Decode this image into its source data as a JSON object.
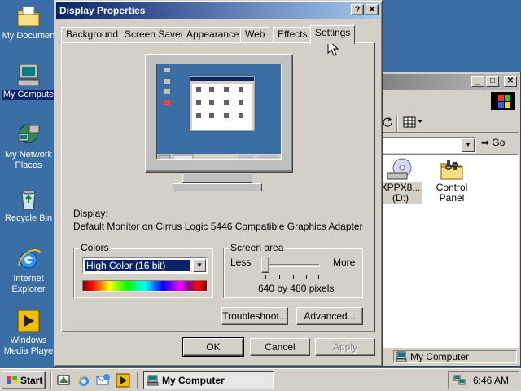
{
  "desktop": {
    "icons": [
      {
        "label": "My Documen",
        "icon": "folder-documents-icon",
        "selected": false
      },
      {
        "label": "My Compute",
        "icon": "computer-icon",
        "selected": true
      },
      {
        "label_line1": "My Network",
        "label_line2": "Places",
        "icon": "network-places-icon"
      },
      {
        "label": "Recycle Bin",
        "icon": "recycle-bin-icon"
      },
      {
        "label_line1": "Internet",
        "label_line2": "Explorer",
        "icon": "internet-explorer-icon"
      },
      {
        "label_line1": "Windows",
        "label_line2": "Media Playe",
        "icon": "media-player-icon"
      }
    ]
  },
  "explorer": {
    "address_go": "Go",
    "items": [
      {
        "label_line1": "XPPX8...",
        "label_line2": "(D:)",
        "icon": "cd-drive-icon"
      },
      {
        "label": "Control Panel",
        "icon": "control-panel-icon"
      }
    ],
    "status": "My Computer"
  },
  "dialog": {
    "title": "Display Properties",
    "help_glyph": "?",
    "close_glyph": "✕",
    "tabs": [
      {
        "label": "Background",
        "active": false
      },
      {
        "label": "Screen Saver",
        "active": false
      },
      {
        "label": "Appearance",
        "active": false
      },
      {
        "label": "Web",
        "active": false
      },
      {
        "label": "Effects",
        "active": false
      },
      {
        "label": "Settings",
        "active": true
      }
    ],
    "display_label": "Display:",
    "display_value": "Default Monitor on Cirrus Logic 5446 Compatible Graphics Adapter",
    "colors": {
      "label": "Colors",
      "selected": "High Color (16 bit)"
    },
    "screen_area": {
      "label": "Screen area",
      "less": "Less",
      "more": "More",
      "value": "640 by 480 pixels",
      "slider_level": 0
    },
    "buttons": {
      "troubleshoot": "Troubleshoot...",
      "advanced": "Advanced...",
      "ok": "OK",
      "cancel": "Cancel",
      "apply": "Apply"
    }
  },
  "taskbar": {
    "start_label": "Start",
    "task_label": "My Computer",
    "clock": "6:46 AM",
    "quicklaunch": [
      "show-desktop-icon",
      "internet-explorer-icon",
      "outlook-express-icon",
      "media-player-icon"
    ]
  },
  "colors": {
    "desktop": "#3a6ea5",
    "title_active": "#0a246a",
    "face": "#d4d0c8"
  }
}
